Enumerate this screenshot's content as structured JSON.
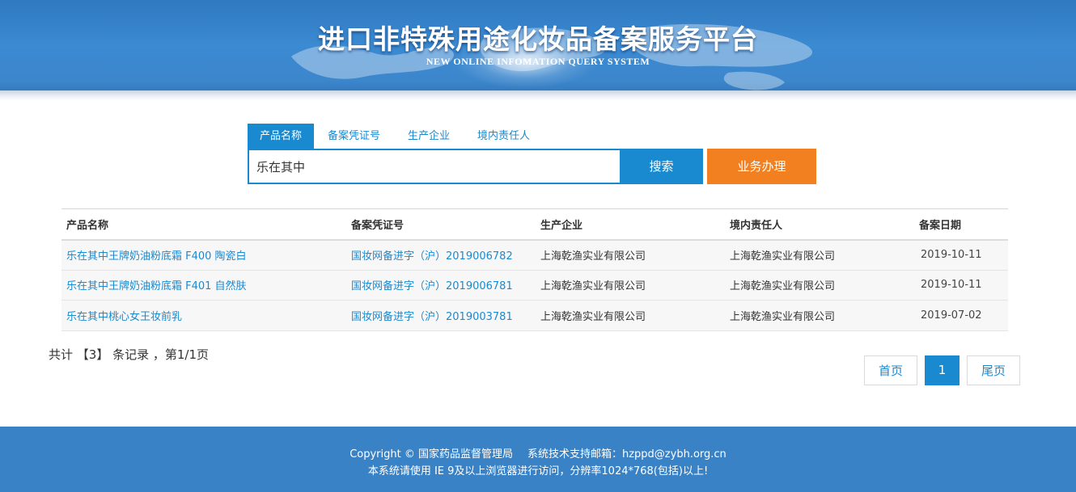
{
  "header": {
    "title": "进口非特殊用途化妆品备案服务平台",
    "subtitle": "NEW ONLINE INFOMATION QUERY SYSTEM"
  },
  "search": {
    "tabs": [
      {
        "label": "产品名称",
        "active": true
      },
      {
        "label": "备案凭证号",
        "active": false
      },
      {
        "label": "生产企业",
        "active": false
      },
      {
        "label": "境内责任人",
        "active": false
      }
    ],
    "value": "乐在其中",
    "placeholder": "",
    "search_button": "搜索",
    "business_button": "业务办理"
  },
  "table": {
    "headers": [
      "产品名称",
      "备案凭证号",
      "生产企业",
      "境内责任人",
      "备案日期"
    ],
    "rows": [
      {
        "name": "乐在其中王牌奶油粉底霜 F400 陶瓷白",
        "cert": "国妆网备进字（沪）2019006782",
        "maker": "上海乾渔实业有限公司",
        "agent": "上海乾渔实业有限公司",
        "date": "2019-10-11"
      },
      {
        "name": "乐在其中王牌奶油粉底霜 F401 自然肤",
        "cert": "国妆网备进字（沪）2019006781",
        "maker": "上海乾渔实业有限公司",
        "agent": "上海乾渔实业有限公司",
        "date": "2019-10-11"
      },
      {
        "name": "乐在其中桃心女王妆前乳",
        "cert": "国妆网备进字（沪）2019003781",
        "maker": "上海乾渔实业有限公司",
        "agent": "上海乾渔实业有限公司",
        "date": "2019-07-02"
      }
    ]
  },
  "summary": {
    "prefix": "共计 ",
    "count": "【3】",
    "suffix": " 条记录 ，第1/1页"
  },
  "pagination": {
    "first": "首页",
    "current": "1",
    "last": "尾页"
  },
  "footer": {
    "copyright": "Copyright © 国家药品监督管理局",
    "email": "系统技术支持邮箱：hzppd@zybh.org.cn",
    "notice": "本系统请使用 IE 9及以上浏览器进行访问，分辨率1024*768(包括)以上!"
  },
  "colors": {
    "primary": "#1a8ad0",
    "accent": "#f27f20",
    "footer": "#3a82c6"
  }
}
